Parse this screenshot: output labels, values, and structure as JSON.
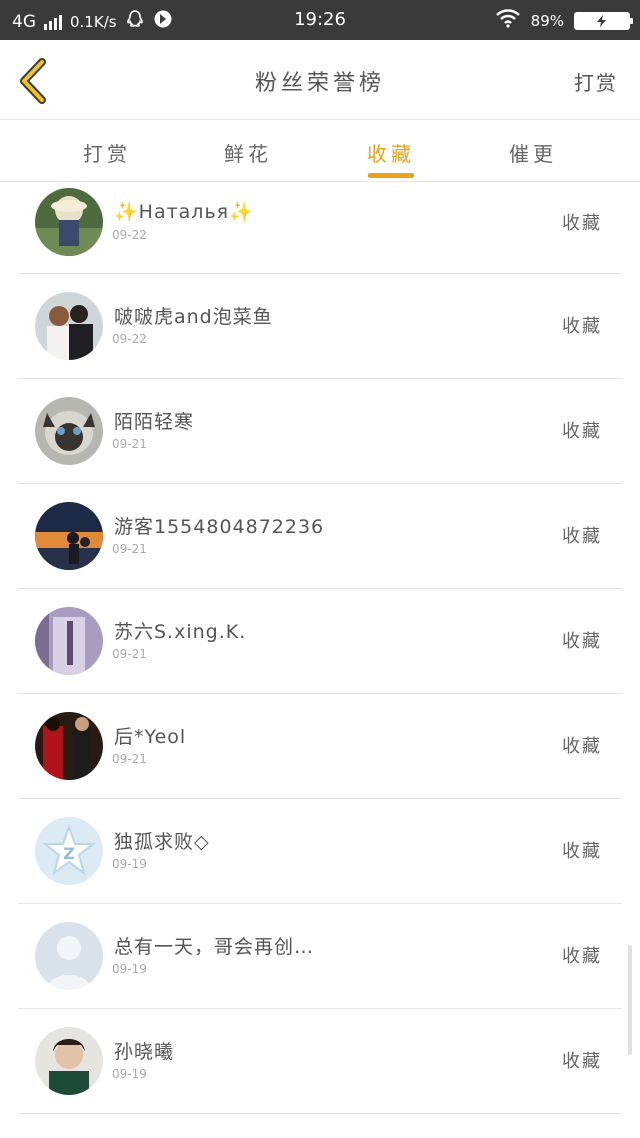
{
  "status_bar": {
    "network": "4G",
    "speed": "0.1K/s",
    "time": "19:26",
    "battery": "89%"
  },
  "header": {
    "title": "粉丝荣誉榜",
    "right_link": "打赏"
  },
  "tabs": [
    {
      "label": "打赏",
      "active": false
    },
    {
      "label": "鲜花",
      "active": false
    },
    {
      "label": "收藏",
      "active": true
    },
    {
      "label": "催更",
      "active": false
    }
  ],
  "accent_color": "#e8a21c",
  "list": [
    {
      "name": "✨Наталья✨",
      "date": "09-22",
      "action": "收藏",
      "avatar_icon": "avatar-photo-hat"
    },
    {
      "name": "啵啵虎and泡菜鱼",
      "date": "09-22",
      "action": "收藏",
      "avatar_icon": "avatar-photo-couple"
    },
    {
      "name": "陌陌轻寒",
      "date": "09-21",
      "action": "收藏",
      "avatar_icon": "avatar-photo-cat"
    },
    {
      "name": "游客1554804872236",
      "date": "09-21",
      "action": "收藏",
      "avatar_icon": "avatar-photo-sunset"
    },
    {
      "name": "苏六S.xing.K.",
      "date": "09-21",
      "action": "收藏",
      "avatar_icon": "avatar-photo-purple"
    },
    {
      "name": "后*Yeol",
      "date": "09-21",
      "action": "收藏",
      "avatar_icon": "avatar-photo-red"
    },
    {
      "name": "独孤求败◇",
      "date": "09-19",
      "action": "收藏",
      "avatar_icon": "avatar-qzone-star"
    },
    {
      "name": "总有一天，哥会再创…",
      "date": "09-19",
      "action": "收藏",
      "avatar_icon": "avatar-default-person"
    },
    {
      "name": "孙晓曦",
      "date": "09-19",
      "action": "收藏",
      "avatar_icon": "avatar-photo-boy"
    }
  ]
}
